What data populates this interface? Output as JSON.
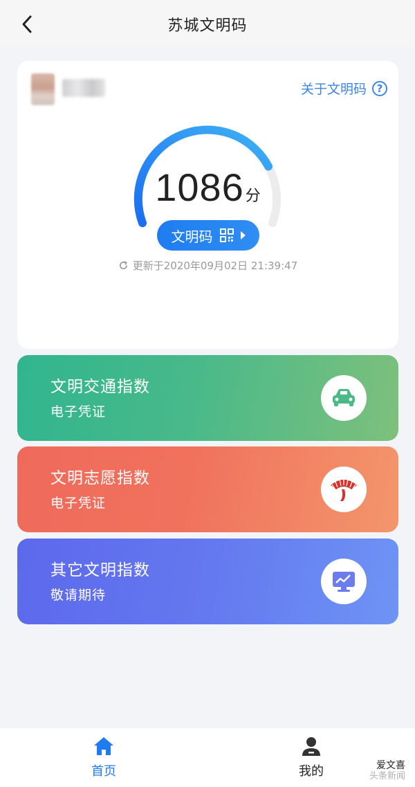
{
  "header": {
    "title": "苏城文明码",
    "back_icon": "chevron-left-icon"
  },
  "score_card": {
    "about_label": "关于文明码",
    "help_icon": "question-circle-icon",
    "score": "1086",
    "score_unit": "分",
    "code_button_label": "文明码",
    "qr_icon": "qr-code-icon",
    "updated_text": "更新于2020年09月02日 21:39:47",
    "refresh_icon": "refresh-icon",
    "gauge_level": 0.78,
    "colors": {
      "gauge_start": "#1b6ff0",
      "gauge_end": "#3fb2f5",
      "track": "#ececef",
      "accent": "#3a86e8"
    }
  },
  "index_cards": [
    {
      "title": "文明交通指数",
      "subtitle": "电子凭证",
      "icon": "car-icon",
      "color": "#3bb58c"
    },
    {
      "title": "文明志愿指数",
      "subtitle": "电子凭证",
      "icon": "volunteer-logo-icon",
      "color": "#f07060"
    },
    {
      "title": "其它文明指数",
      "subtitle": "敬请期待",
      "icon": "monitor-chart-icon",
      "color": "#6272ee"
    }
  ],
  "bottom_nav": [
    {
      "label": "首页",
      "icon": "home-icon",
      "active": true
    },
    {
      "label": "我的",
      "icon": "user-icon",
      "active": false
    }
  ],
  "watermark": {
    "line1": "爱文喜",
    "line2": "头条新闻"
  }
}
